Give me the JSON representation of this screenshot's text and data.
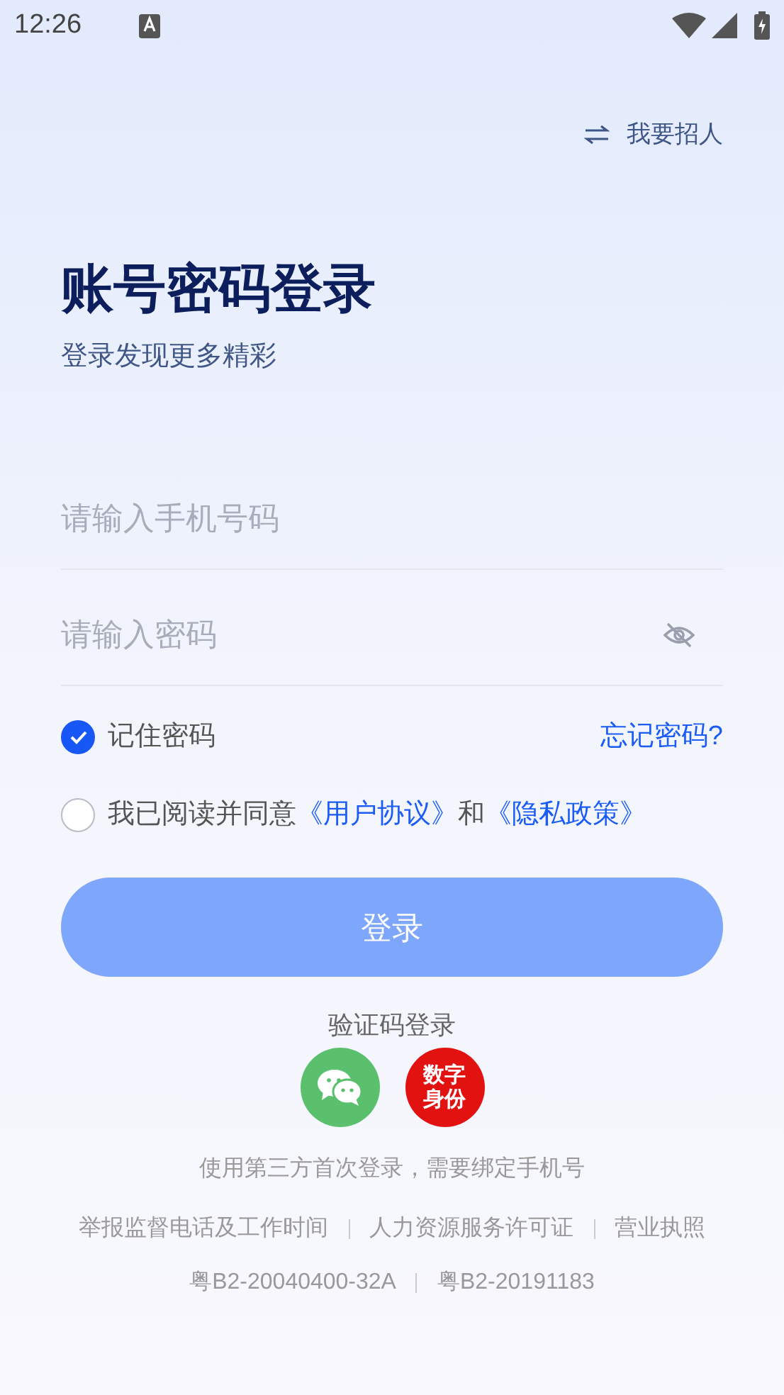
{
  "status_bar": {
    "time": "12:26"
  },
  "switch_link": {
    "label": "我要招人"
  },
  "title": "账号密码登录",
  "subtitle": "登录发现更多精彩",
  "phone_field": {
    "placeholder": "请输入手机号码"
  },
  "password_field": {
    "placeholder": "请输入密码"
  },
  "remember": {
    "label": "记住密码",
    "checked": true
  },
  "forgot_link": "忘记密码?",
  "agreement": {
    "checked": false,
    "parts": [
      {
        "kind": "text",
        "text": "我已阅读并同意"
      },
      {
        "kind": "link",
        "text": "《用户协议》"
      },
      {
        "kind": "text",
        "text": "和"
      },
      {
        "kind": "link",
        "text": "《隐私政策》"
      }
    ]
  },
  "login_button": {
    "label": "登录",
    "disabled": true
  },
  "sms_login_link": "验证码登录",
  "third_party": [
    {
      "kind": "wechat"
    },
    {
      "kind": "digital_id",
      "text_lines": [
        "数字",
        "身份"
      ]
    }
  ],
  "third_party_note": "使用第三方首次登录，需要绑定手机号",
  "footer_links": [
    "举报监督电话及工作时间",
    "人力资源服务许可证",
    "营业执照"
  ],
  "licenses": [
    "粤B2-20040400-32A",
    "粤B2-20191183"
  ]
}
